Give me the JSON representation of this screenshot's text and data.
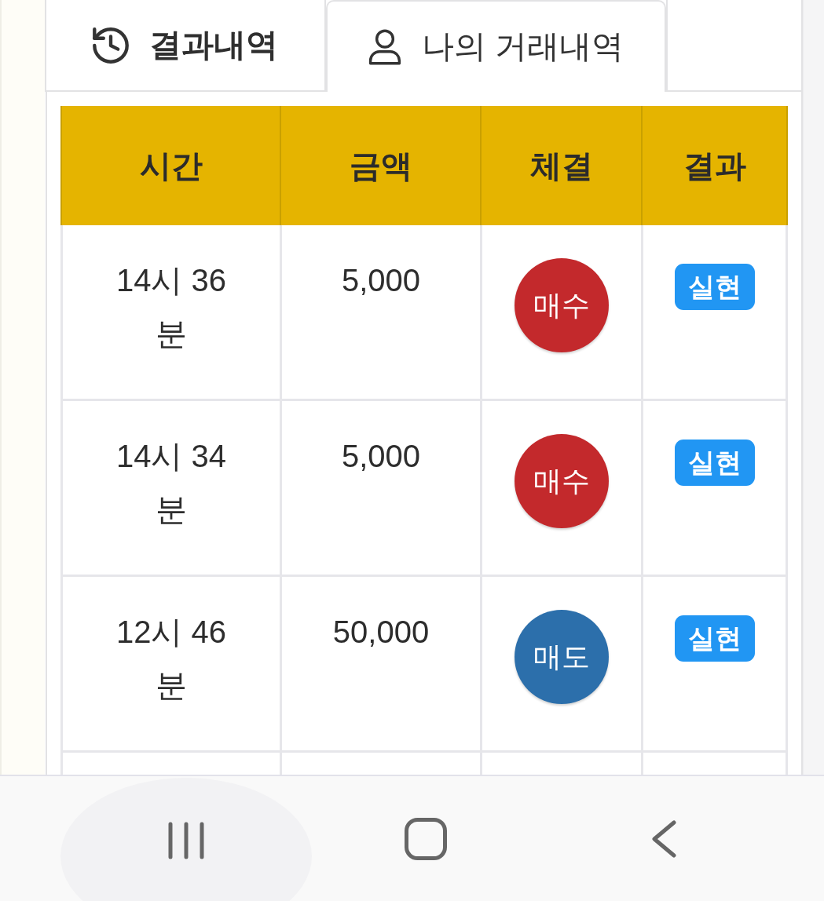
{
  "tabs": [
    {
      "kind": "results",
      "label": "결과내역",
      "selected": false
    },
    {
      "kind": "my_trades",
      "label": "나의 거래내역",
      "selected": true
    },
    {
      "kind": "blank",
      "selected": false
    }
  ],
  "table": {
    "columns": [
      "시간",
      "금액",
      "체결",
      "결과"
    ],
    "rows": [
      {
        "time": "14시 36 분",
        "amount": "5,000",
        "trade": {
          "label": "매수",
          "color": "#c3292c"
        },
        "result": {
          "label": "실현"
        }
      },
      {
        "time": "14시 34 분",
        "amount": "5,000",
        "trade": {
          "label": "매수",
          "color": "#c3292c"
        },
        "result": {
          "label": "실현"
        }
      },
      {
        "time": "12시 46 분",
        "amount": "50,000",
        "trade": {
          "label": "매도",
          "color": "#2c6fab"
        },
        "result": {
          "label": "실현"
        }
      }
    ]
  },
  "nav_bar": {
    "buttons": [
      {
        "kind": "recents",
        "pressed": true
      },
      {
        "kind": "home",
        "pressed": false
      },
      {
        "kind": "back",
        "pressed": false
      }
    ]
  }
}
